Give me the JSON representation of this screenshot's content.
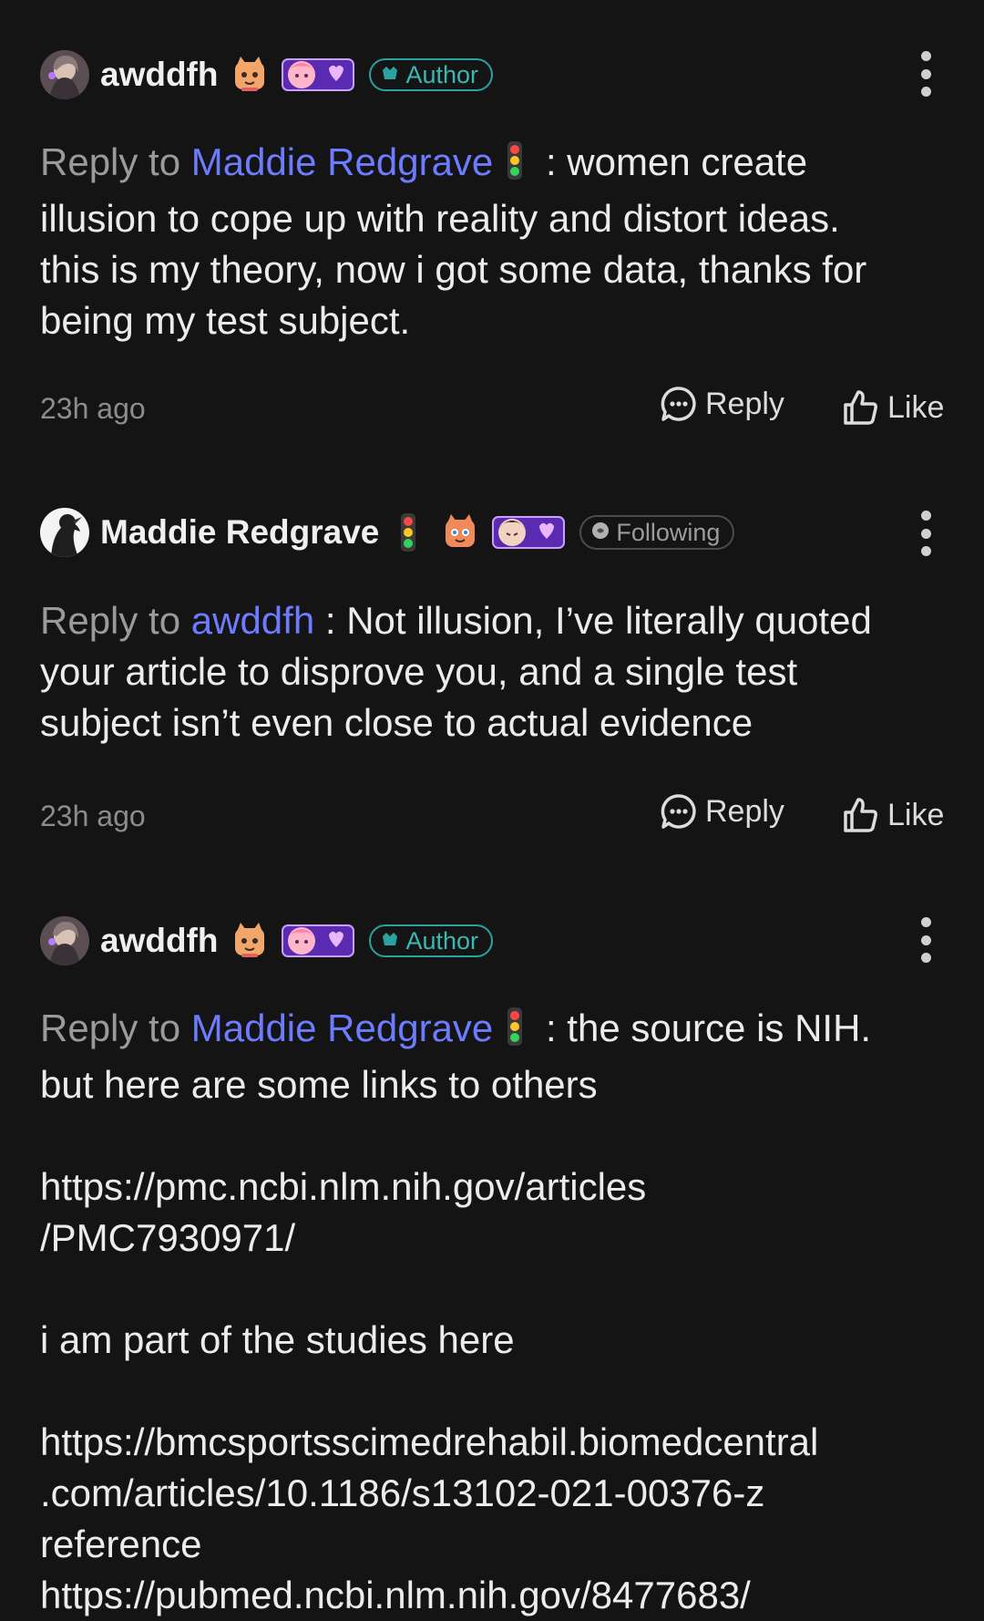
{
  "comments": [
    {
      "username": "awddfh",
      "badge": "Author",
      "reply_prefix": "Reply to ",
      "mention": "Maddie Redgrave",
      "text_lines": [
        " : women create",
        "illusion to cope up with reality and distort ideas.",
        "this is my theory, now i got some data, thanks for",
        "being my test subject."
      ],
      "time": "23h ago",
      "reply_label": "Reply",
      "like_label": "Like"
    },
    {
      "username": "Maddie Redgrave",
      "badge": "Following",
      "reply_prefix": "Reply to ",
      "mention": "awddfh",
      "text_lines": [
        " : Not illusion, I’ve literally quoted",
        "your article to disprove you, and a single test",
        "subject isn’t even close to actual evidence"
      ],
      "time": "23h ago",
      "reply_label": "Reply",
      "like_label": "Like"
    },
    {
      "username": "awddfh",
      "badge": "Author",
      "reply_prefix": "Reply to ",
      "mention": "Maddie Redgrave",
      "text_lines": [
        " : the source is NIH.",
        "but here are some links to others",
        "",
        "https://pmc.ncbi.nlm.nih.gov/articles",
        "/PMC7930971/",
        "",
        "i am part of the studies here",
        "",
        "https://bmcsportsscimedrehabil.biomedcentral",
        ".com/articles/10.1186/s13102-021-00376-z",
        "reference",
        "https://pubmed.ncbi.nlm.nih.gov/8477683/"
      ]
    }
  ],
  "colors": {
    "background": "#141414",
    "mention": "#6d7bff",
    "author_badge": "#2aa3a0",
    "muted": "#8c8c8c"
  },
  "icons": {
    "traffic_light": "traffic-light-icon",
    "reply": "chat-bubble-icon",
    "like": "thumbs-up-icon",
    "more": "vertical-ellipsis-icon"
  }
}
